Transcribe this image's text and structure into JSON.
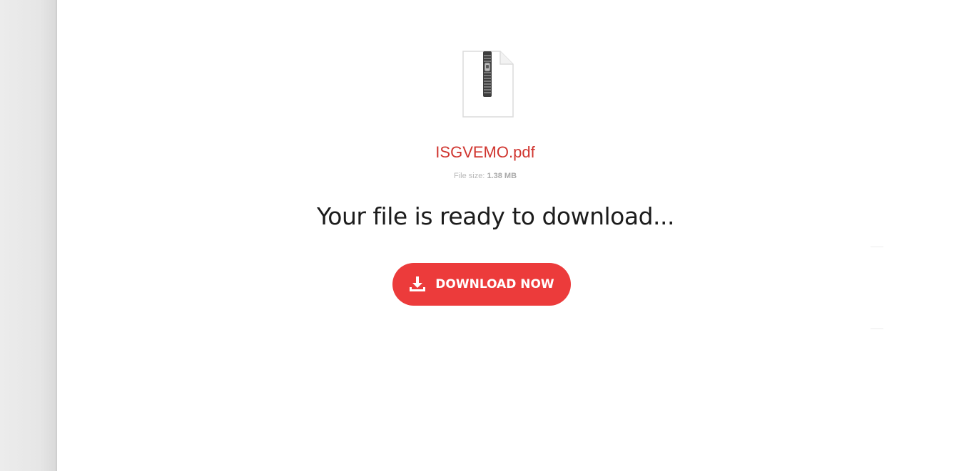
{
  "file": {
    "name": "ISGVEMO.pdf",
    "size_label": "File size:",
    "size_value": "1.38 MB",
    "icon": "zip-file-icon"
  },
  "heading": "Your file is ready to download...",
  "download_button": {
    "label": "DOWNLOAD NOW",
    "icon": "download-icon"
  },
  "colors": {
    "accent": "#ec3b3b",
    "file_name": "#d0352f",
    "heading": "#1c1c1c"
  }
}
